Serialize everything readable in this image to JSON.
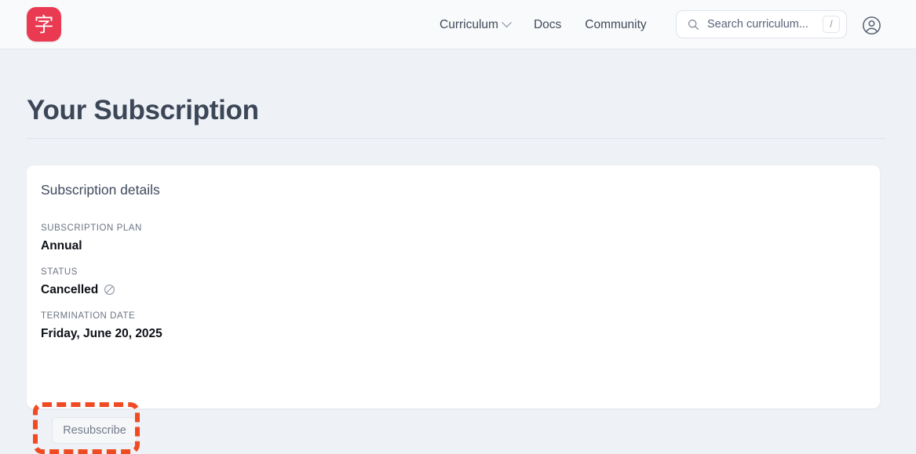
{
  "header": {
    "logo": {
      "glyph": "字",
      "name": "logo-icon",
      "color": "#e93a52"
    },
    "nav": [
      {
        "label": "Curriculum",
        "has_chevron": true
      },
      {
        "label": "Docs",
        "has_chevron": false
      },
      {
        "label": "Community",
        "has_chevron": false
      }
    ],
    "search": {
      "placeholder": "Search curriculum...",
      "value": "",
      "shortcut": "/"
    },
    "account_icon": "user-circle-icon"
  },
  "main": {
    "page_title": "Your Subscription",
    "card": {
      "title": "Subscription details",
      "fields": [
        {
          "label": "SUBSCRIPTION PLAN",
          "value": "Annual",
          "icon": ""
        },
        {
          "label": "STATUS",
          "value": "Cancelled",
          "icon": "prohibited-icon"
        },
        {
          "label": "TERMINATION DATE",
          "value": "Friday, June 20, 2025",
          "icon": ""
        }
      ],
      "resubscribe_label": "Resubscribe"
    }
  },
  "annotation": {
    "target": "resubscribe-button",
    "color": "#ef4a22",
    "style": "dashed-rectangle"
  }
}
